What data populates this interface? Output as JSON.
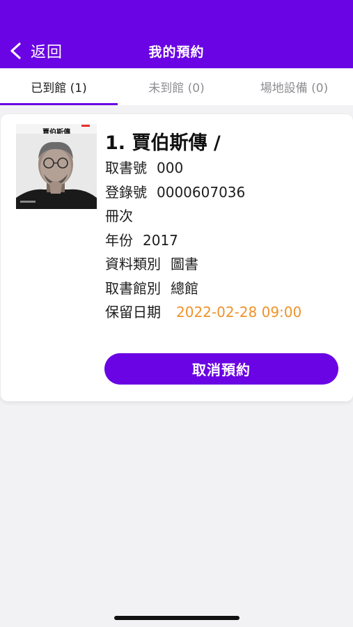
{
  "header": {
    "back_label": "返回",
    "title": "我的預約"
  },
  "tabs": [
    {
      "label": "已到館 (1)",
      "active": true
    },
    {
      "label": "未到館 (0)",
      "active": false
    },
    {
      "label": "場地設備 (0)",
      "active": false
    }
  ],
  "reservation": {
    "title": "1. 賈伯斯傳 /",
    "cover_title": "賈伯斯傳",
    "fields": [
      {
        "label": "取書號",
        "value": "000"
      },
      {
        "label": "登錄號",
        "value": "0000607036"
      },
      {
        "label": "冊次",
        "value": ""
      },
      {
        "label": "年份",
        "value": "2017"
      },
      {
        "label": "資料類別",
        "value": "圖書"
      },
      {
        "label": "取書館別",
        "value": "總館"
      }
    ],
    "hold_date_label": "保留日期",
    "hold_date_value": "2022-02-28 09:00",
    "cancel_label": "取消預約"
  },
  "colors": {
    "accent": "#6a04e4",
    "date": "#f0922b"
  }
}
